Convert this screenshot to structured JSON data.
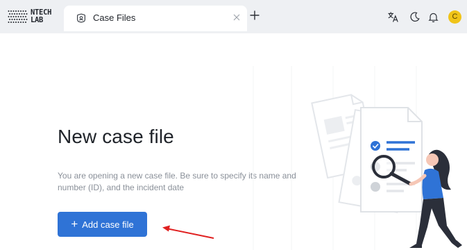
{
  "header": {
    "logo_line1": "NTECH",
    "logo_line2": "LAB",
    "tab_label": "Case Files",
    "avatar_initial": "C"
  },
  "main": {
    "title": "New case file",
    "description": "You are opening a new case file. Be sure to specify its name and number (ID), and the incident date",
    "add_button_label": "Add case file"
  },
  "icons": {
    "tab": "badge-icon",
    "tab_close": "close-icon",
    "new_tab": "plus-icon",
    "translate": "translate-icon",
    "theme": "moon-icon",
    "notifications": "bell-icon",
    "arrow": "red-arrow-icon"
  },
  "colors": {
    "topbar": "#eef0f3",
    "accent": "#2f73d6",
    "avatar": "#f0c419",
    "arrow": "#e02020"
  }
}
